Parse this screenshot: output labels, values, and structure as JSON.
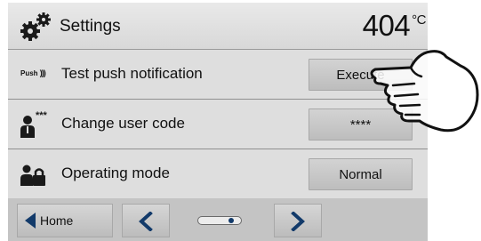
{
  "header": {
    "title": "Settings",
    "temperature": "404",
    "temperature_unit": "°C",
    "icon": "gears-icon"
  },
  "rows": [
    {
      "icon": "push-notification-icon",
      "icon_text": "Push",
      "label": "Test push notification",
      "button": "Execute"
    },
    {
      "icon": "user-code-icon",
      "label": "Change user code",
      "button": "****"
    },
    {
      "icon": "operating-mode-icon",
      "label": "Operating mode",
      "button": "Normal"
    }
  ],
  "footer": {
    "home_label": "Home",
    "prev_icon": "chevron-left-icon",
    "next_icon": "chevron-right-icon",
    "page_indicator": {
      "pages": 2,
      "current": 2
    }
  },
  "overlay": {
    "icon": "pointing-hand-icon"
  },
  "colors": {
    "accent": "#123a6a",
    "background": "#dedede"
  }
}
